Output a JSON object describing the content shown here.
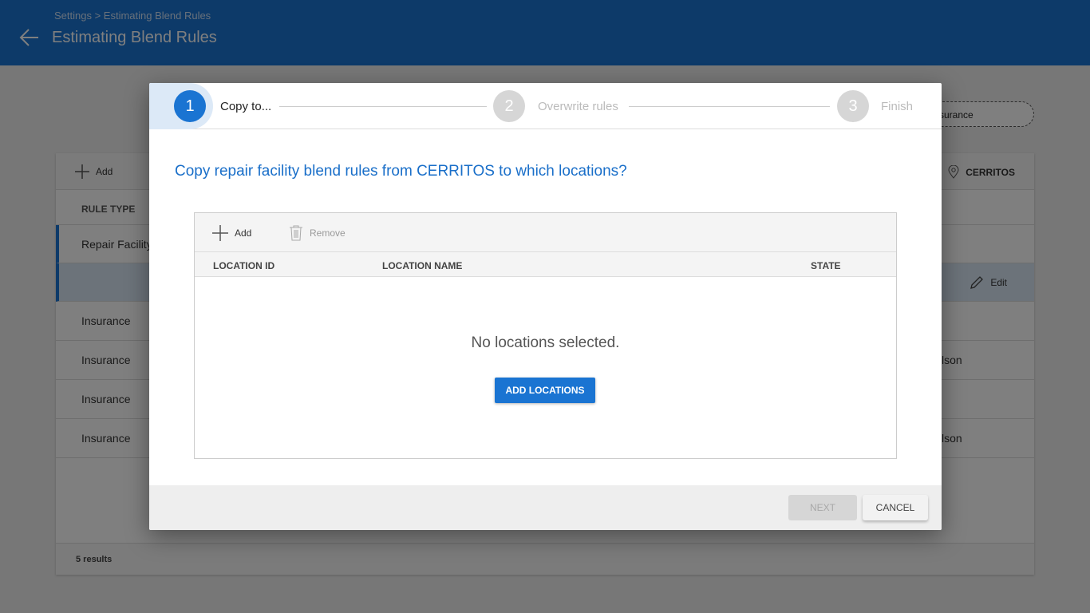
{
  "header": {
    "breadcrumb": "Settings > Estimating Blend Rules",
    "title": "Estimating Blend Rules"
  },
  "background": {
    "filter_chip": "surance",
    "toolbar": {
      "add_label": "Add",
      "location_label": "CERRITOS"
    },
    "columns": [
      "RULE TYPE"
    ],
    "rows": [
      {
        "rule_type": "Repair Facility",
        "right": ""
      },
      {
        "rule_type": "",
        "right": "Edit"
      },
      {
        "rule_type": "Insurance",
        "right": ""
      },
      {
        "rule_type": "Insurance",
        "right": "lson"
      },
      {
        "rule_type": "Insurance",
        "right": ""
      },
      {
        "rule_type": "Insurance",
        "right": "lson"
      }
    ],
    "results": "5 results"
  },
  "modal": {
    "steps": [
      {
        "number": "1",
        "label": "Copy to..."
      },
      {
        "number": "2",
        "label": "Overwrite rules"
      },
      {
        "number": "3",
        "label": "Finish"
      }
    ],
    "question": "Copy repair facility blend rules from CERRITOS to which locations?",
    "toolbar": {
      "add_label": "Add",
      "remove_label": "Remove"
    },
    "columns": {
      "id": "LOCATION ID",
      "name": "LOCATION NAME",
      "state": "STATE"
    },
    "empty_text": "No locations selected.",
    "add_locations_label": "ADD LOCATIONS",
    "next_label": "NEXT",
    "cancel_label": "CANCEL"
  },
  "colors": {
    "primary": "#1a74d2",
    "inactive_step": "#d6d6d6"
  }
}
